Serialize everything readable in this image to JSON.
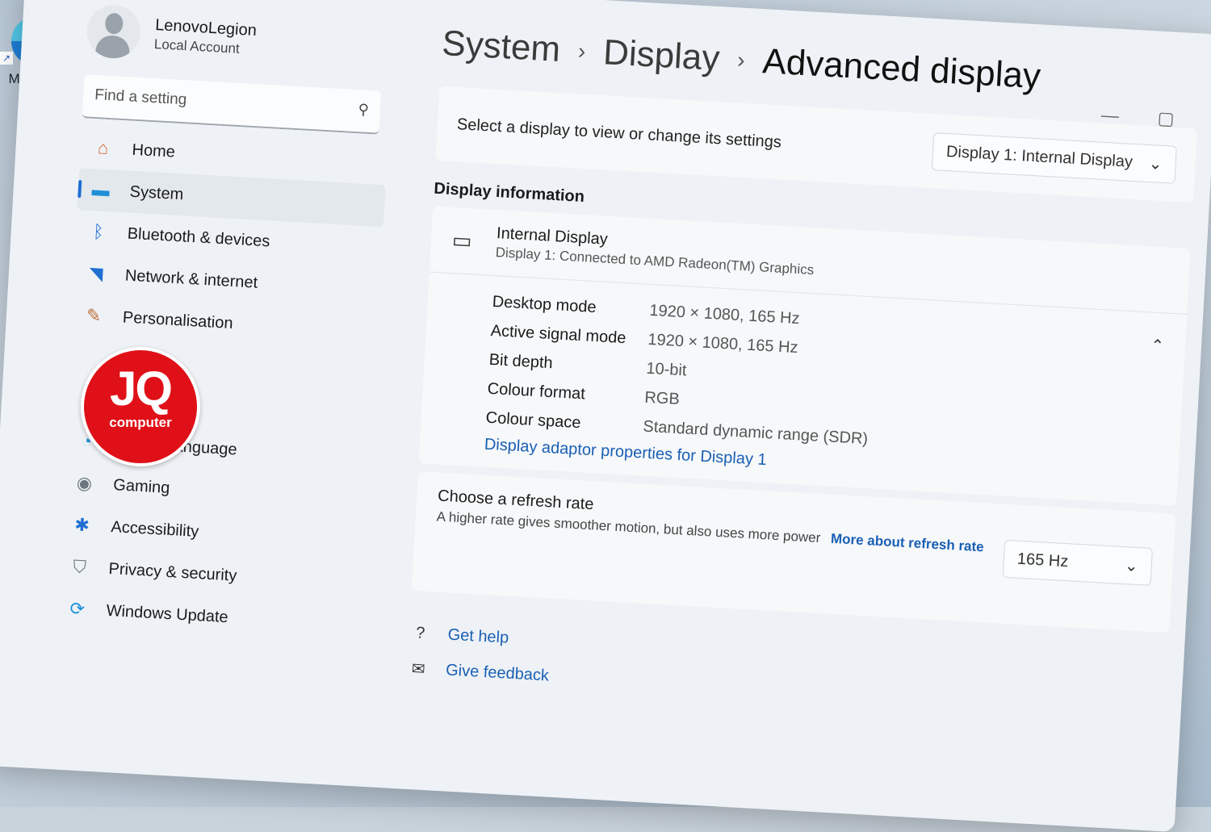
{
  "desktop": {
    "edge_label": "Microsoft Edge"
  },
  "user": {
    "name": "LenovoLegion",
    "type": "Local Account"
  },
  "search": {
    "placeholder": "Find a setting"
  },
  "nav": [
    {
      "label": "Home",
      "icon": "home-icon"
    },
    {
      "label": "System",
      "icon": "system-icon",
      "active": true
    },
    {
      "label": "Bluetooth & devices",
      "icon": "bluetooth-icon"
    },
    {
      "label": "Network & internet",
      "icon": "wifi-icon"
    },
    {
      "label": "Personalisation",
      "icon": "brush-icon"
    },
    {
      "label": "Time & language",
      "icon": "clock-globe-icon"
    },
    {
      "label": "Gaming",
      "icon": "gamepad-icon"
    },
    {
      "label": "Accessibility",
      "icon": "accessibility-icon"
    },
    {
      "label": "Privacy & security",
      "icon": "shield-icon"
    },
    {
      "label": "Windows Update",
      "icon": "update-icon"
    }
  ],
  "breadcrumb": {
    "level1": "System",
    "level2": "Display",
    "current": "Advanced display"
  },
  "select_display": {
    "label": "Select a display to view or change its settings",
    "value": "Display 1: Internal Display"
  },
  "display_info": {
    "title": "Display information",
    "name": "Internal Display",
    "subtitle": "Display 1: Connected to AMD Radeon(TM) Graphics",
    "props": [
      {
        "label": "Desktop mode",
        "value": "1920 × 1080, 165 Hz"
      },
      {
        "label": "Active signal mode",
        "value": "1920 × 1080, 165 Hz"
      },
      {
        "label": "Bit depth",
        "value": "10-bit"
      },
      {
        "label": "Colour format",
        "value": "RGB"
      },
      {
        "label": "Colour space",
        "value": "Standard dynamic range (SDR)"
      }
    ],
    "adapter_link": "Display adaptor properties for Display 1"
  },
  "refresh": {
    "title": "Choose a refresh rate",
    "description": "A higher rate gives smoother motion, but also uses more power",
    "link": "More about refresh rate",
    "value": "165 Hz"
  },
  "help": {
    "get_help": "Get help",
    "give_feedback": "Give feedback"
  },
  "badge": {
    "big": "JQ",
    "small": "computer"
  },
  "colors": {
    "accent": "#1f6fd1",
    "link": "#1a5fb4",
    "badge": "#e01018"
  }
}
